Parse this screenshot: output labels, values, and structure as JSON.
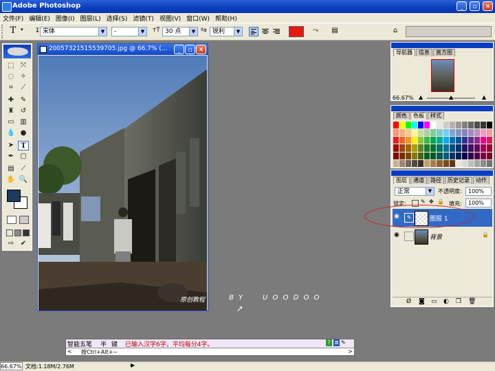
{
  "window": {
    "title": "Adobe Photoshop"
  },
  "menu": [
    "文件(F)",
    "编辑(E)",
    "图像(I)",
    "图层(L)",
    "选择(S)",
    "滤镜(T)",
    "视图(V)",
    "窗口(W)",
    "帮助(H)"
  ],
  "options": {
    "tool_glyph": "T",
    "font_family": "宋体",
    "font_style": "-",
    "font_size": "30 点",
    "aa_label": "ªa",
    "aa_mode": "锐利",
    "color": "#e8190c"
  },
  "document": {
    "title": "20057321515539705.jpg @ 66.7% (..."
  },
  "watermark": {
    "label": "原创教程",
    "by": "B Y",
    "name": "U O O D O O"
  },
  "navigator": {
    "tabs": [
      "导航器",
      "信息",
      "直方图"
    ],
    "zoom": "66.67%"
  },
  "swatches": {
    "tabs": [
      "颜色",
      "色板",
      "样式"
    ],
    "colors": [
      "#ff0000",
      "#ffff00",
      "#00ff00",
      "#00ffff",
      "#0000ff",
      "#ff00ff",
      "#ffffff",
      "#e6e6e6",
      "#cccccc",
      "#b3b3b3",
      "#999999",
      "#808080",
      "#666666",
      "#4d4d4d",
      "#333333",
      "#000000",
      "#f7977a",
      "#f9ad81",
      "#fdc68a",
      "#fff79a",
      "#c4df9b",
      "#a2d39c",
      "#82ca9d",
      "#7bcdc8",
      "#6ecff6",
      "#7ea7d8",
      "#8493ca",
      "#8882be",
      "#a187be",
      "#bc8dbf",
      "#f49ac2",
      "#f6989d",
      "#ed1c24",
      "#f26522",
      "#f7941d",
      "#fff200",
      "#8dc73f",
      "#39b54a",
      "#00a651",
      "#00a99d",
      "#00aeef",
      "#0072bc",
      "#0054a6",
      "#2e3192",
      "#662d91",
      "#92278f",
      "#ec008c",
      "#ed145b",
      "#9e0b0f",
      "#a0410d",
      "#a36209",
      "#aba000",
      "#598527",
      "#1a7b30",
      "#007236",
      "#00746b",
      "#0076a3",
      "#004b80",
      "#003471",
      "#1b1464",
      "#440e62",
      "#630460",
      "#9e005d",
      "#9e0039",
      "#790000",
      "#7b2e00",
      "#7d4900",
      "#827b00",
      "#406618",
      "#005e20",
      "#005826",
      "#005952",
      "#005b7f",
      "#003663",
      "#002157",
      "#0d004c",
      "#32004b",
      "#4b0049",
      "#7b0046",
      "#7a0026",
      "#c7b299",
      "#998675",
      "#736357",
      "#534741",
      "#37302d",
      "#c69c6d",
      "#a67c52",
      "#8c6239",
      "#754c24",
      "#603913",
      "#e6e6e6",
      "#d9d9d9",
      "#bfbfbf",
      "#a6a6a6",
      "#8c8c8c",
      "#737373"
    ]
  },
  "layers_panel": {
    "tabs": [
      "图层",
      "通道",
      "路径",
      "历史记录",
      "动作"
    ],
    "blend_mode": "正常",
    "opacity_label": "不透明度:",
    "opacity": "100%",
    "lock_label": "锁定:",
    "fill_label": "填充:",
    "fill": "100%",
    "layers": [
      {
        "name": "图层 1",
        "selected": true
      },
      {
        "name": "背景",
        "selected": false
      }
    ]
  },
  "ime": {
    "name": "智能五笔",
    "mode": "半",
    "punct": "键",
    "message": "已输入汉字6字，平均每分4字。",
    "hint": "按Ctrl+Alt+~"
  },
  "status": {
    "zoom": "66.67%",
    "doc": "文档:1.18M/2.76M"
  }
}
